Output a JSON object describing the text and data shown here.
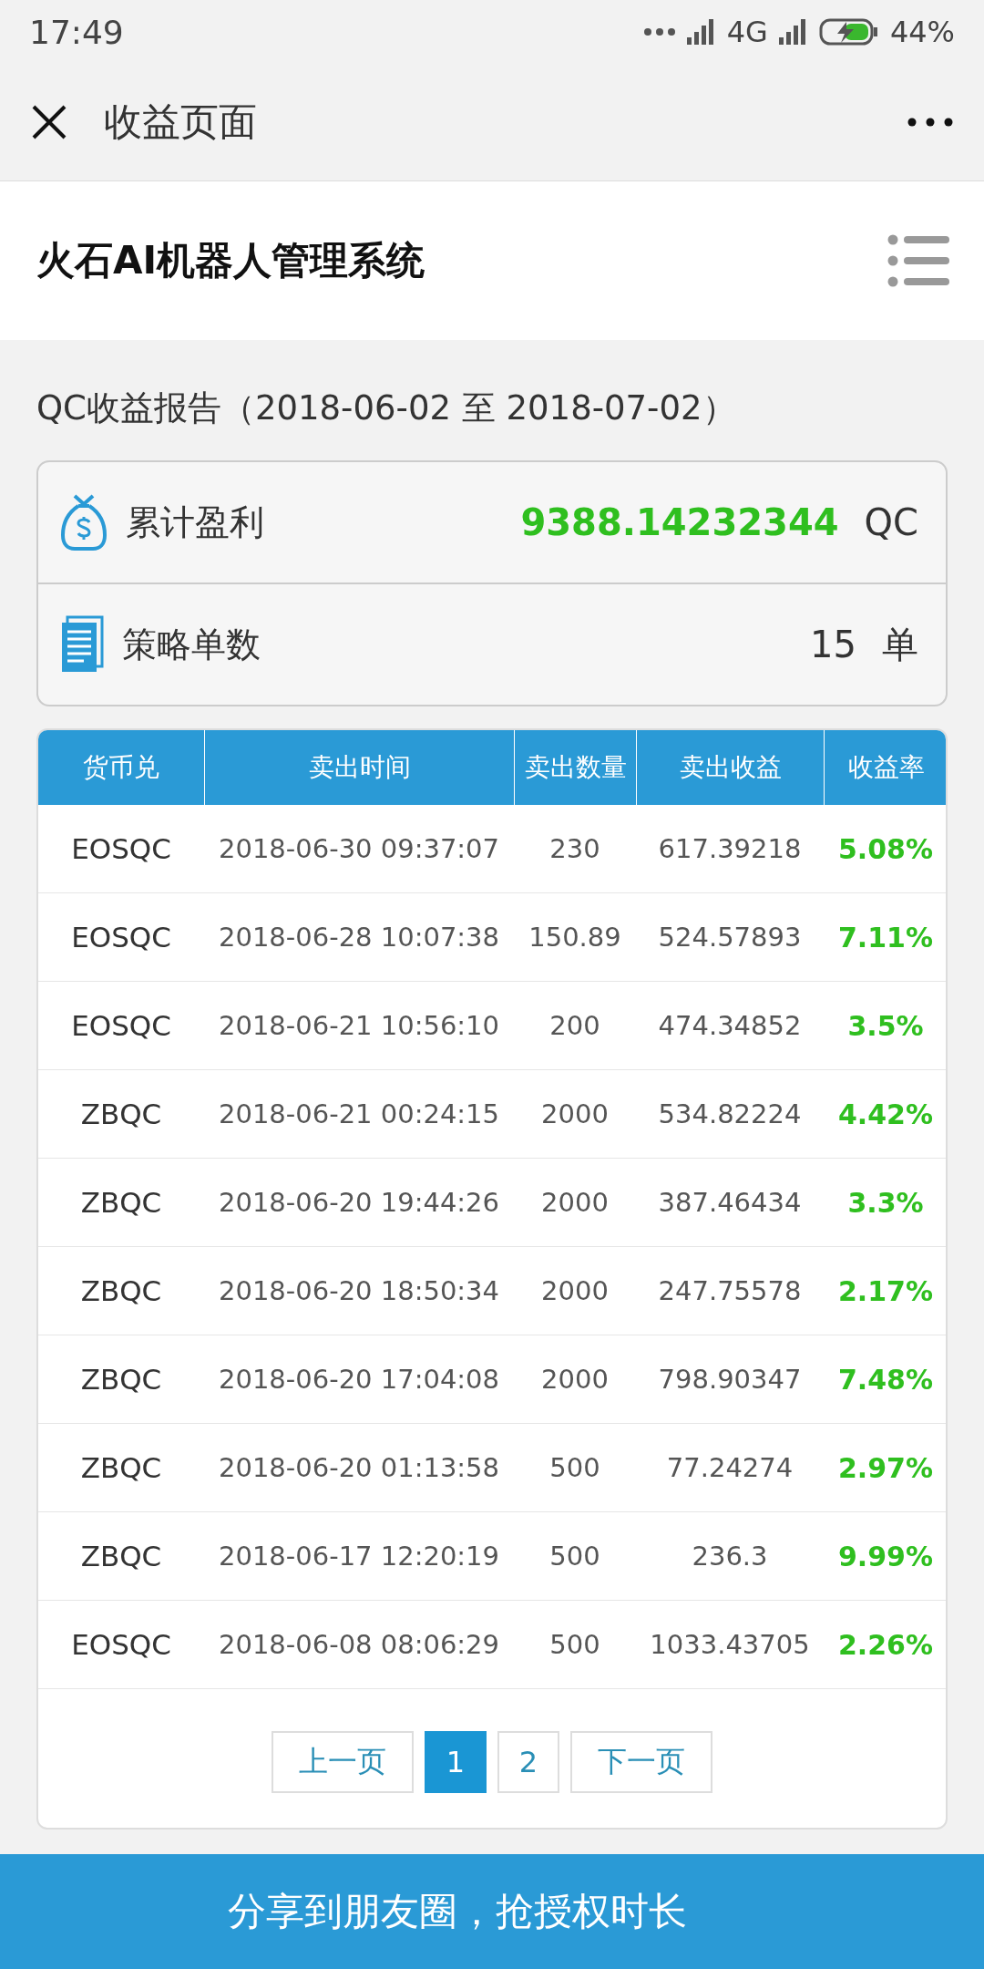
{
  "status_bar": {
    "time": "17:49",
    "network": "4G",
    "battery": "44%"
  },
  "nav_bar": {
    "title": "收益页面"
  },
  "header": {
    "title": "火石AI机器人管理系统"
  },
  "report": {
    "title": "QC收益报告（2018-06-02 至 2018-07-02）"
  },
  "summary": [
    {
      "kind": "profit",
      "label": "累计盈利",
      "value": "9388.14232344",
      "unit": "QC"
    },
    {
      "kind": "orders",
      "label": "策略单数",
      "value": "15",
      "unit": "单"
    }
  ],
  "table": {
    "columns": [
      "货币兑",
      "卖出时间",
      "卖出数量",
      "卖出收益",
      "收益率"
    ],
    "rows": [
      [
        "EOSQC",
        "2018-06-30 09:37:07",
        "230",
        "617.39218",
        "5.08%"
      ],
      [
        "EOSQC",
        "2018-06-28 10:07:38",
        "150.89",
        "524.57893",
        "7.11%"
      ],
      [
        "EOSQC",
        "2018-06-21 10:56:10",
        "200",
        "474.34852",
        "3.5%"
      ],
      [
        "ZBQC",
        "2018-06-21 00:24:15",
        "2000",
        "534.82224",
        "4.42%"
      ],
      [
        "ZBQC",
        "2018-06-20 19:44:26",
        "2000",
        "387.46434",
        "3.3%"
      ],
      [
        "ZBQC",
        "2018-06-20 18:50:34",
        "2000",
        "247.75578",
        "2.17%"
      ],
      [
        "ZBQC",
        "2018-06-20 17:04:08",
        "2000",
        "798.90347",
        "7.48%"
      ],
      [
        "ZBQC",
        "2018-06-20 01:13:58",
        "500",
        "77.24274",
        "2.97%"
      ],
      [
        "ZBQC",
        "2018-06-17 12:20:19",
        "500",
        "236.3",
        "9.99%"
      ],
      [
        "EOSQC",
        "2018-06-08 08:06:29",
        "500",
        "1033.43705",
        "2.26%"
      ]
    ]
  },
  "pagination": {
    "previous": "上一页",
    "pages": [
      {
        "label": "1",
        "selected": true
      },
      {
        "label": "2",
        "selected": false
      }
    ],
    "next": "下一页"
  },
  "share_button": {
    "label": "分享到朋友圈，抢授权时长"
  }
}
